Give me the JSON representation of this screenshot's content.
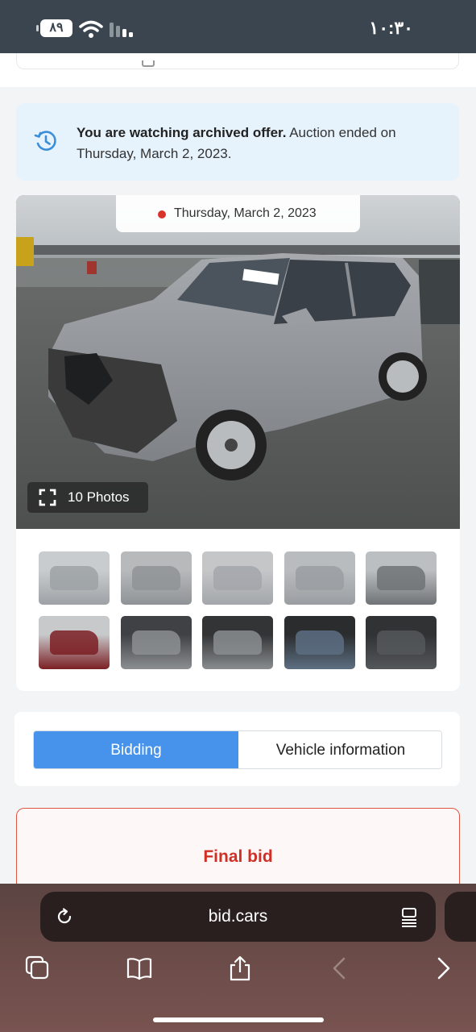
{
  "status_bar": {
    "battery": "٨٩",
    "time": "١٠:٣٠"
  },
  "notice": {
    "bold_text": "You are watching archived offer.",
    "rest_text": " Auction ended on Thursday, March 2, 2023."
  },
  "gallery": {
    "date": "Thursday, March 2, 2023",
    "photos_label": "10 Photos",
    "thumbnails": 10
  },
  "tabs": {
    "bidding": "Bidding",
    "vehicle_information": "Vehicle information",
    "active": "bidding"
  },
  "final_bid": {
    "label": "Final bid"
  },
  "browser": {
    "url": "bid.cars"
  },
  "colors": {
    "status_bar_bg": "#3b4550",
    "notice_bg": "#e6f3fd",
    "active_tab": "#4793ec",
    "final_bid_accent": "#cf2f25",
    "live_dot": "#d9342b"
  }
}
